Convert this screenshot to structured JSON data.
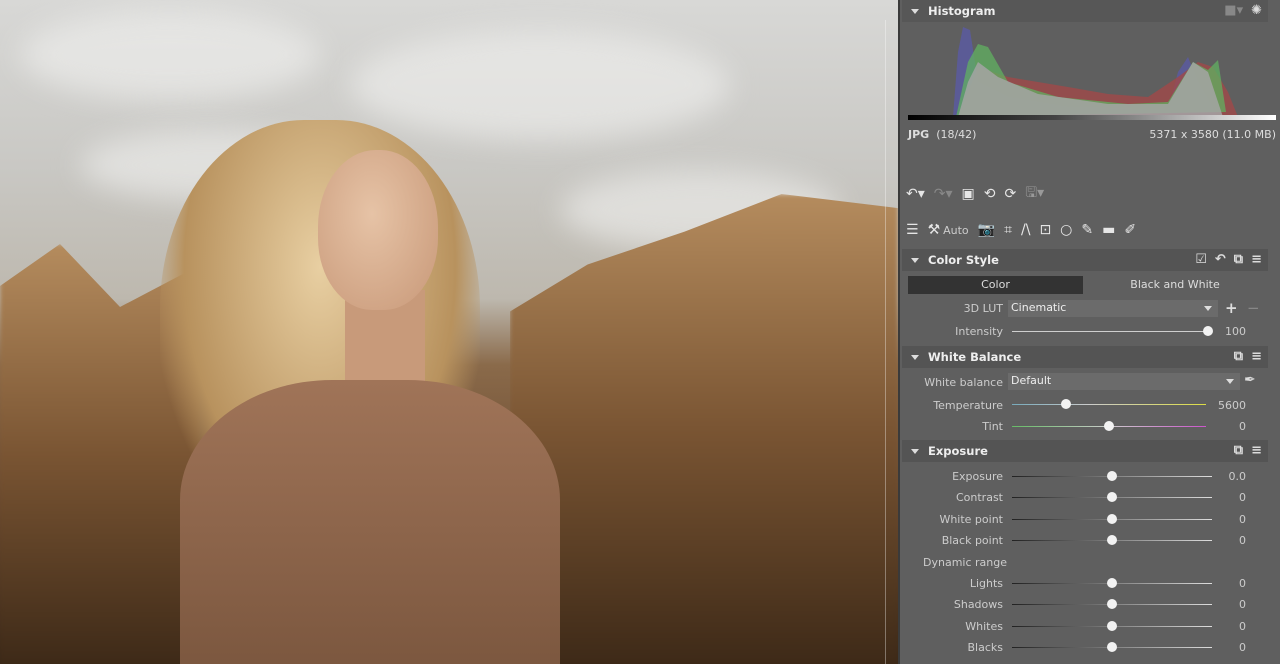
{
  "histogram": {
    "title": "Histogram",
    "format": "JPG",
    "index": "(18/42)",
    "dimensions": "5371 x 3580 (11.0 MB)"
  },
  "toolbar": {
    "auto_label": "Auto"
  },
  "color_style": {
    "title": "Color Style",
    "tabs": [
      "Color",
      "Black and White"
    ],
    "active_tab": "Color",
    "lut_label": "3D LUT",
    "lut_value": "Cinematic",
    "intensity_label": "Intensity",
    "intensity_value": "100",
    "intensity": 100
  },
  "white_balance": {
    "title": "White Balance",
    "wb_label": "White balance",
    "wb_value": "Default",
    "temperature_label": "Temperature",
    "temperature_value": "5600",
    "tint_label": "Tint",
    "tint_value": "0"
  },
  "exposure": {
    "title": "Exposure",
    "rows": [
      {
        "label": "Exposure",
        "value": "0.0"
      },
      {
        "label": "Contrast",
        "value": "0"
      },
      {
        "label": "White point",
        "value": "0"
      },
      {
        "label": "Black point",
        "value": "0"
      }
    ],
    "dynamic_range_label": "Dynamic range",
    "dr_rows": [
      {
        "label": "Lights",
        "value": "0"
      },
      {
        "label": "Shadows",
        "value": "0"
      },
      {
        "label": "Whites",
        "value": "0"
      },
      {
        "label": "Blacks",
        "value": "0"
      }
    ]
  }
}
